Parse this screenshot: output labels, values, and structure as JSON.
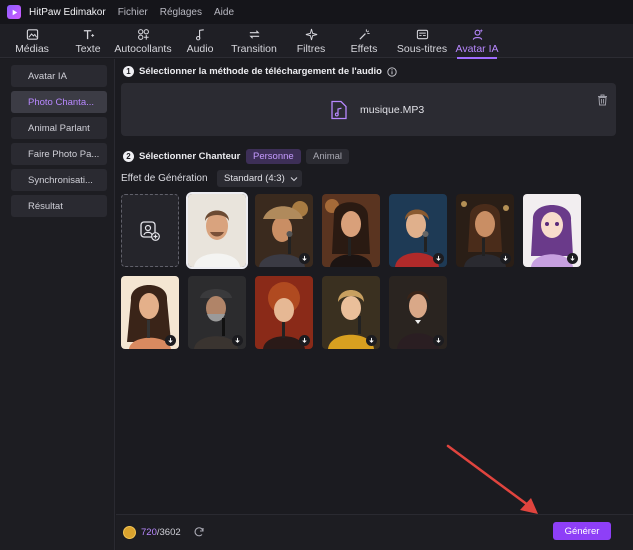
{
  "titlebar": {
    "app_name": "HitPaw Edimakor",
    "menus": [
      "Fichier",
      "Réglages",
      "Aide"
    ]
  },
  "toolbar": {
    "tabs": [
      {
        "label": "Médias",
        "icon": "media-icon"
      },
      {
        "label": "Texte",
        "icon": "text-icon"
      },
      {
        "label": "Autocollants",
        "icon": "sticker-icon"
      },
      {
        "label": "Audio",
        "icon": "music-note-icon"
      },
      {
        "label": "Transition",
        "icon": "transition-icon"
      },
      {
        "label": "Filtres",
        "icon": "filter-sparkle-icon"
      },
      {
        "label": "Effets",
        "icon": "effects-icon"
      },
      {
        "label": "Sous-titres",
        "icon": "subtitles-icon"
      },
      {
        "label": "Avatar IA",
        "icon": "avatar-icon",
        "active": true
      }
    ]
  },
  "sidebar": {
    "items": [
      {
        "label": "Avatar IA"
      },
      {
        "label": "Photo Chanta...",
        "active": true
      },
      {
        "label": "Animal Parlant"
      },
      {
        "label": "Faire Photo Pa..."
      },
      {
        "label": "Synchronisati..."
      },
      {
        "label": "Résultat"
      }
    ]
  },
  "step1": {
    "number": "1",
    "title": "Sélectionner la méthode de téléchargement de l'audio",
    "file_name": "musique.MP3"
  },
  "step2": {
    "number": "2",
    "title": "Sélectionner Chanteur",
    "options": [
      {
        "label": "Personne",
        "active": true
      },
      {
        "label": "Animal",
        "active": false
      }
    ],
    "effect_label": "Effet de Génération",
    "effect_value": "Standard (4:3)"
  },
  "singers": [
    {
      "name": "singer-1",
      "selected": true,
      "download": false
    },
    {
      "name": "singer-2",
      "download": true
    },
    {
      "name": "singer-3",
      "download": false
    },
    {
      "name": "singer-4",
      "download": true
    },
    {
      "name": "singer-5",
      "download": true
    },
    {
      "name": "singer-6",
      "download": true
    },
    {
      "name": "singer-7",
      "download": true
    },
    {
      "name": "singer-8",
      "download": true
    },
    {
      "name": "singer-9",
      "download": true
    },
    {
      "name": "singer-10",
      "download": true
    },
    {
      "name": "singer-11",
      "download": true
    }
  ],
  "footer": {
    "credits_used": "720",
    "credits_total": "/3602",
    "generate_label": "Générer"
  },
  "colors": {
    "accent": "#8e3ff7",
    "accent_text": "#b888ff",
    "annotation_arrow": "#e0443e"
  }
}
